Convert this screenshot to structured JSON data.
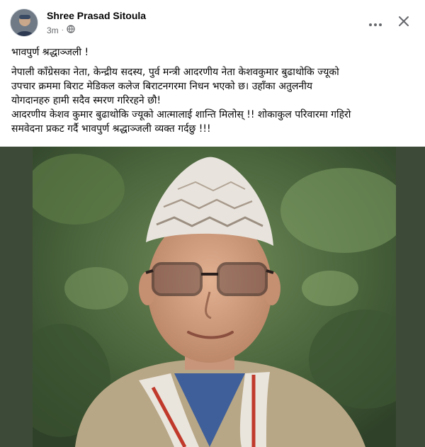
{
  "post": {
    "author": "Shree Prasad Sitoula",
    "time": "3m",
    "privacy_icon": "globe-icon",
    "more_icon": "more-horizontal-icon",
    "close_icon": "close-icon",
    "text_lines": [
      "भावपुर्ण श्रद्धाञ्जली !",
      "नेपाली काँग्रेसका नेता, केन्द्रीय सदस्य, पुर्व मन्त्री आदरणीय नेता केशवकुमार बुढाथोकि ज्यूको",
      "उपचार क्रममा बिराट मेडिकल कलेज बिराटनगरमा निधन भएको छ। उहाँका अतुलनीय",
      "योगदानहरु हामी सदैव स्मरण गरिरहने छौ!",
      "आदरणीय केशव कुमार बुढाथोकि ज्यूको आत्मालाई शान्ति मिलोस् !! शोकाकुल परिवारमा गहिरो",
      "समवेदना प्रकट गर्दै भावपुर्ण श्रद्धाञ्जली व्यक्त गर्दछु !!!"
    ]
  },
  "colors": {
    "photo_background": "#3e4a38",
    "meta_text": "#65676b"
  }
}
